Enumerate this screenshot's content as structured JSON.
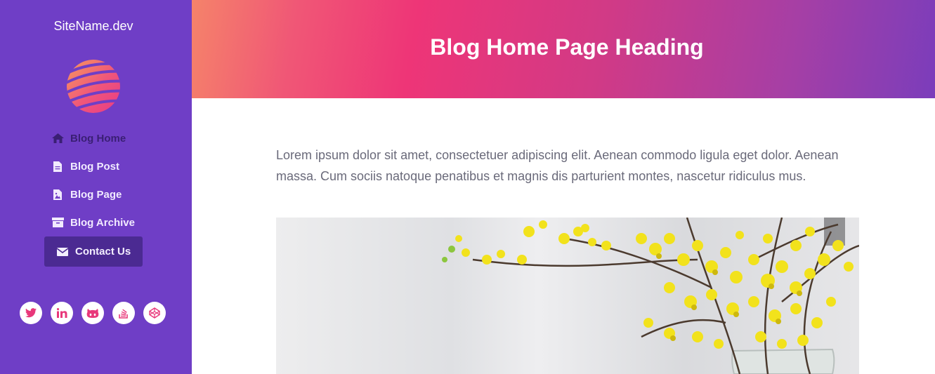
{
  "sidebar": {
    "site_name": "SiteName.dev",
    "nav": [
      {
        "label": "Blog Home",
        "icon": "home-icon"
      },
      {
        "label": "Blog Post",
        "icon": "file-icon"
      },
      {
        "label": "Blog Page",
        "icon": "file-image-icon"
      },
      {
        "label": "Blog Archive",
        "icon": "archive-icon"
      },
      {
        "label": "Contact Us",
        "icon": "envelope-icon"
      }
    ],
    "socials": [
      "twitter-icon",
      "linkedin-icon",
      "github-icon",
      "stackoverflow-icon",
      "codepen-icon"
    ]
  },
  "header": {
    "title": "Blog Home Page Heading"
  },
  "main": {
    "intro": "Lorem ipsum dolor sit amet, consectetuer adipiscing elit. Aenean commodo ligula eget dolor. Aenean massa. Cum sociis natoque penatibus et magnis dis parturient montes, nascetur ridiculus mus."
  },
  "colors": {
    "sidebar_bg": "#6f3ec6",
    "nav_active_bg": "#4b2a92",
    "accent_pink": "#ee3577",
    "social_icon": "#e8387a"
  }
}
